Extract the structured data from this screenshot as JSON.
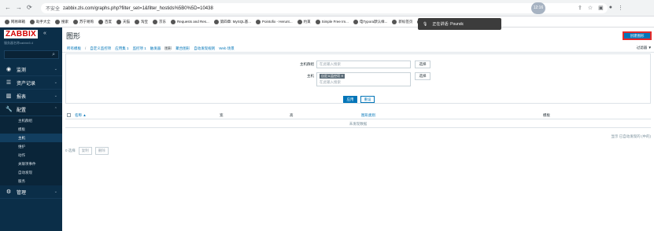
{
  "browser": {
    "url": "zabbix.zls.com/graphs.php?filter_set=1&filter_hostids%5B0%5D=10438",
    "insecure_label": "不安全",
    "time": "12:16",
    "bookmarks": [
      "网易邮箱",
      "助手大全",
      "搜索",
      "苏宁易购",
      "百度",
      "天猫",
      "淘宝",
      "京东",
      "Requests and Res...",
      "第四章: MySQL基...",
      "Pointofix - Herunt...",
      "约束",
      "Simple Free Im...",
      "电Typora默认样...",
      "新标签页",
      "Sakurairo - 鸢尾猫..."
    ],
    "voice": {
      "label": "正在讲话: Poundc"
    }
  },
  "sidebar": {
    "logo": "ZABBIX",
    "collapse": "«",
    "server": "服务器名称zabbix5.4",
    "search_placeholder": "",
    "menu": [
      {
        "label": "监测",
        "icon": "eye-icon"
      },
      {
        "label": "资产记录",
        "icon": "list-icon"
      },
      {
        "label": "报表",
        "icon": "chart-icon"
      },
      {
        "label": "配置",
        "icon": "wrench-icon"
      },
      {
        "label": "管理",
        "icon": "gear-icon"
      }
    ],
    "submenu": [
      "主机群组",
      "模板",
      "主机",
      "维护",
      "动作",
      "关联项事件",
      "自动发现",
      "服务"
    ]
  },
  "main": {
    "title": "图形",
    "create_button": "创建图形",
    "filter_tab": "过滤器",
    "subnav": [
      "所有模板",
      "自定义监控项",
      "应用集 1",
      "监控项 1",
      "触发器",
      "图形",
      "聚合图形",
      "自动发现规则",
      "Web 场景"
    ],
    "filter": {
      "host_group_label": "主机群组",
      "host_group_placeholder": "在此输入搜索",
      "host_label": "主机",
      "host_chip": "自定义监控项",
      "host_placeholder": "在此输入搜索",
      "select_label": "选择",
      "apply_label": "应用",
      "reset_label": "重设"
    },
    "table": {
      "columns": [
        "名称 ▲",
        "宽",
        "高",
        "图形类别",
        "模板"
      ],
      "nodata": "未发现数据",
      "count": "显示 已自动发现的 (中的)"
    },
    "bulk": {
      "selected": "0 选择",
      "copy": "复制",
      "delete": "删除"
    }
  }
}
